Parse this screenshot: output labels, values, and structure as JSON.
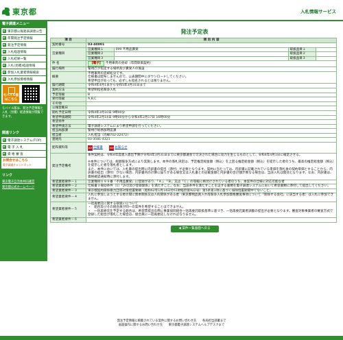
{
  "header": {
    "logo_text": "東京都",
    "service_title": "入札情報サービス"
  },
  "sidebar": {
    "menu_title": "電子調達メニュー",
    "items": [
      {
        "label": "東京都公報発表調達公告"
      },
      {
        "label": "年間発注予定情報"
      },
      {
        "label": "発注予定情報"
      },
      {
        "label": "入札経過情報"
      },
      {
        "label": "入札結果一覧"
      },
      {
        "label": "入札(見積)経過情報"
      },
      {
        "label": "参加入札業者情報検索"
      },
      {
        "label": "入札参加資格情報"
      }
    ],
    "mobile_label": "モバイル版",
    "mobile_sub": "はこちら",
    "mobile_note": "モバイル版は、発注予定情報と入札（見積）経過情報が閲覧できます。",
    "links_title": "関連リンク",
    "links": [
      {
        "label": "電子調達システム(TOP)"
      },
      {
        "label": "電 子 入 札"
      },
      {
        "label": "資 格 審 査"
      }
    ],
    "orange_label": "お問合せはこちら",
    "orange_sub": "電子調達チャットボット",
    "bottom_title": "リンク",
    "bottom_links": [
      {
        "label": "東京電子自治体共同運営"
      },
      {
        "label": "東京都公式ホームページ"
      }
    ]
  },
  "main": {
    "title": "発注予定表",
    "head_item": "項 目",
    "head_content": "項 目 内 容",
    "rows": {
      "contract_no_label": "契約番号",
      "contract_no": "03-40001",
      "business_type_label": "営業種目",
      "business_type_1_label": "営業種目１",
      "business_type_1_value": "099 不用品賣受",
      "business_type_2_label": "営業種目２",
      "business_type_3_label": "営業種目３",
      "handling_1_label": "取扱品目１",
      "handling_2_label": "取扱品目２",
      "handling_3_label": "取扱品目３",
      "subject_label": "件 名",
      "subject_tag": "【電子】",
      "subject": "不用車両の売却（年間単価契約）",
      "location_label": "履行場所",
      "location": "警視庁が指定する場所及び賣受人の施設",
      "summary_label": "概要",
      "summary_1": "不用車両の売却処分です。",
      "summary_2": "仕様書は配布しませんので、公表期間中にダウンロードしてください。",
      "summary_3": "希望申出があっても、必ずしも指名されるとは限りません。",
      "period_label": "履行期間",
      "period": "令和4年4月1日から令和5年3月31日まで",
      "method_label": "契約方法",
      "method": "希望制指名競争入札",
      "rank_label": "予定等級",
      "rank": "B",
      "accept_rank_label": "受付等級",
      "accept_rank": "A,B,C",
      "other_label": "その他",
      "bid_date_label": "公報登載日",
      "open_date_label": "開札予定日時",
      "open_date": "令和4年3月10日 9時00分",
      "hope_period_label": "希望申請期間",
      "hope_period": "令和4年2月14日 9時00分から令和4年2月17日 16時00分",
      "hope_cond_label": "希望条件",
      "method_apply_label": "希望申請方法",
      "method_apply": "電子調達システムにより希望申請を行ってください。",
      "dept_label": "担当局部課",
      "dept": "警視庁総務部用度課",
      "person_label": "担当者",
      "person": "入札担当（内線702-22472）",
      "contact_label": "連絡先",
      "contact": "03-3581-4321",
      "docs_label": "配布資料等",
      "doc_1": "仕様書",
      "doc_2": "お知らせ",
      "note_label": "発注予定備考",
      "note_1": "本件契約は、令和4年度歳入歳出予算が令和4年3月31日までに東京都議会で可決された場合に効力を生じるものとして、令和4年4月1日に確定させる。",
      "note_2": "※本件については、総額競争方式により実施します。本件の落札決定は、予定推定総金額（税込）を上回る推定総金額（税込）を提示した者のうち、最高の推定総金額（税込）を提示した者を落札者とします。",
      "note_3": "また、本件においては、入札書の提出時に内訳書の提出（添付）が必要となります。契約に当たっては、内訳書に記載されている単価を落札後の契約単価とすることから、内訳書の提出（添付）がない場合、内訳書内の計算に誤りがある場合又は入札書との記載金額と内訳書の合計額が異なる場合は、当該入札は無効となります。なお、内訳書は、資格確認通知時に添付します。",
      "req1_label": "希望業者要件－１",
      "req1": "営業種目０９９番「不用品賣受」に登録があり、「Ａ」、「Ｂ」又は「Ｃ」の等級に格付けされている者のうち、本案件の仕様に対応可能な者",
      "req2_label": "希望業者要件－２",
      "req2": "仕様書３冊効条件（1）「許可及び登録関係」を満たすこと。なお、当該条件を満たすことを証する書類を電子調達システムにおいて希望書類に添付して提出してください。",
      "req3_label": "希望業者要件－３",
      "req3": "東京都契約関係暴力団等対策措置要綱（昭和62年1月14日付61財経庶第922号）第5条第1項に基づく排除措置期間中でないこと。",
      "req4_label": "希望業者要件－４",
      "req4": "入札に参加しようとする者の間に資本関係又は人的関係がある者（東京都物品買入れ等競争入札参加資格審査事項について「関係する会社」に該当する者）は入札に参加できません。",
      "req5_label": "希望業者要件－５",
      "req5_1": "一括再委託に関する取扱いについて",
      "req5_2": "・　組合及びその組合員が同一の案件を希望することはできません。",
      "req5_3": "・　一括再委託を予定する組合は、希望票提出の際に事業協同組合一括再委託取扱基準に基づき、一括再委託業者調書の提出が必要となります。審査対象事業者の審査方式で登録した組合が落札した場合は、組合員に一括再委託しなければなりません。",
      "req6_label": "希望業者要件－６"
    },
    "back_label": "◀ 案件一覧画面へ戻る"
  },
  "footer": {
    "line1_a": "発注予定情報に掲載されている案件に関するお問い合わせ先",
    "line1_b": "各局担当部署まで",
    "line2_a": "画面操作に関するお問い合わせ先",
    "line2_b": "東京都電子調達システムヘルプデスクまで"
  },
  "colors": {
    "brand_green": "#2f8f2f",
    "label_bg": "#dff0df",
    "tag_bg": "#c8ffc8"
  }
}
